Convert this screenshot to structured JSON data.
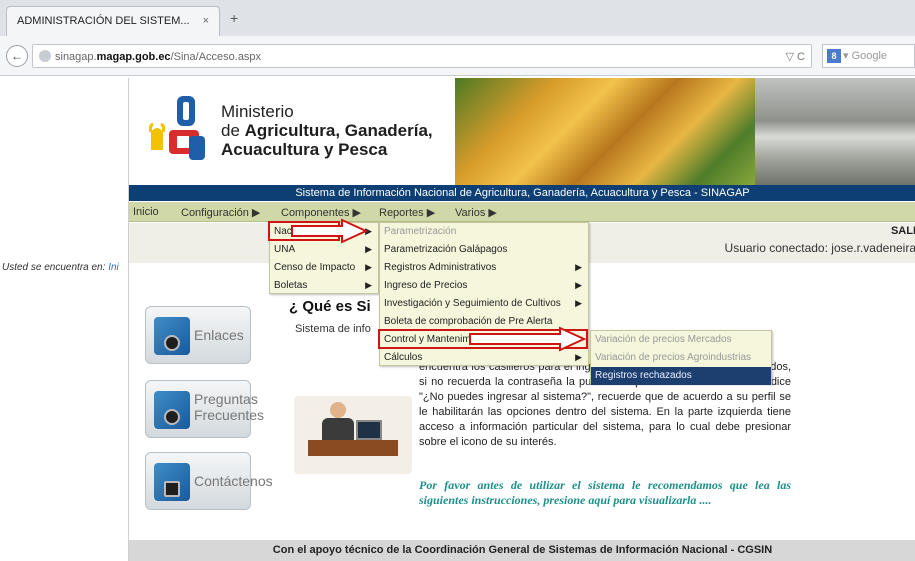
{
  "browser": {
    "tab_title": "ADMINISTRACIÓN DEL SISTEM...",
    "tab_close": "×",
    "new_tab": "+",
    "back": "←",
    "url_host_prefix": "sinagap.",
    "url_host_domain": "magap.gob.ec",
    "url_path": "/Sina/Acceso.aspx",
    "url_right": "▽ C",
    "search_badge": "8",
    "search_placeholder": "▾ Google"
  },
  "header": {
    "ministry_line1": "Ministerio",
    "ministry_line2_prefix": "de ",
    "ministry_line2_bold": "Agricultura, Ganadería,",
    "ministry_line3": "Acuacultura y Pesca"
  },
  "system_bar": "Sistema de Información Nacional de Agricultura, Ganadería, Acuacultura y Pesca - SINAGAP",
  "menubar": {
    "inicio": "Inicio",
    "configuracion": "Configuración ▶",
    "componentes": "Componentes ▶",
    "reportes": "Reportes ▶",
    "varios": "Varios ▶"
  },
  "info": {
    "salir": "SALI",
    "usuario_conectado": "Usuario conectado: jose.r.vadeneira",
    "usted_prefix": "Usted se encuentra en: ",
    "usted_link": "Ini"
  },
  "sidebar": {
    "enlaces": "Enlaces",
    "preguntas_line1": "Preguntas",
    "preguntas_line2": "Frecuentes",
    "contactenos": "Contáctenos"
  },
  "main": {
    "title": "¿ Qué es Si",
    "subtitle": "Sistema de info",
    "body": "encuentra los casilleros para el ingreso de usuario y contraseña asignados, si no recuerda la contraseña la puede recuperar dando un clic donde dice \"¿No puedes ingresar al sistema?\", recuerde que de acuerdo a su perfil se le habilitarán las opciones dentro del sistema. En la parte izquierda tiene acceso a información particular del sistema, para lo cual debe presionar sobre el icono de su interés.",
    "por_favor": "Por favor antes de utilizar el sistema le recomendamos que lea las siguientes instrucciones, presione aquí para visualizarla ...."
  },
  "footer": "Con el apoyo técnico de la Coordinación General de Sistemas de Información Nacional - CGSIN",
  "menus": {
    "componentes_items": [
      "Nacionales",
      "UNA",
      "Censo de Impacto",
      "Boletas"
    ],
    "nacionales_items": [
      "Parametrización",
      "Parametrización Galápagos",
      "Registros Administrativos",
      "Ingreso de Precios",
      "Investigación y Seguimiento de Cultivos",
      "Boleta de comprobación de Pre Alerta",
      "Control y Mantenimiento",
      "Cálculos"
    ],
    "control_items": [
      "Variación de precios Mercados",
      "Variación de precios Agroindustrias",
      "Registros rechazados"
    ],
    "sub_arrow": "▶"
  },
  "colors": {
    "system_bar": "#0d3f74",
    "menubar": "#cfd8a6",
    "highlight_box": "#d01414",
    "selected_item": "#1c3f70",
    "por_favor_text": "#1e8f8a"
  }
}
